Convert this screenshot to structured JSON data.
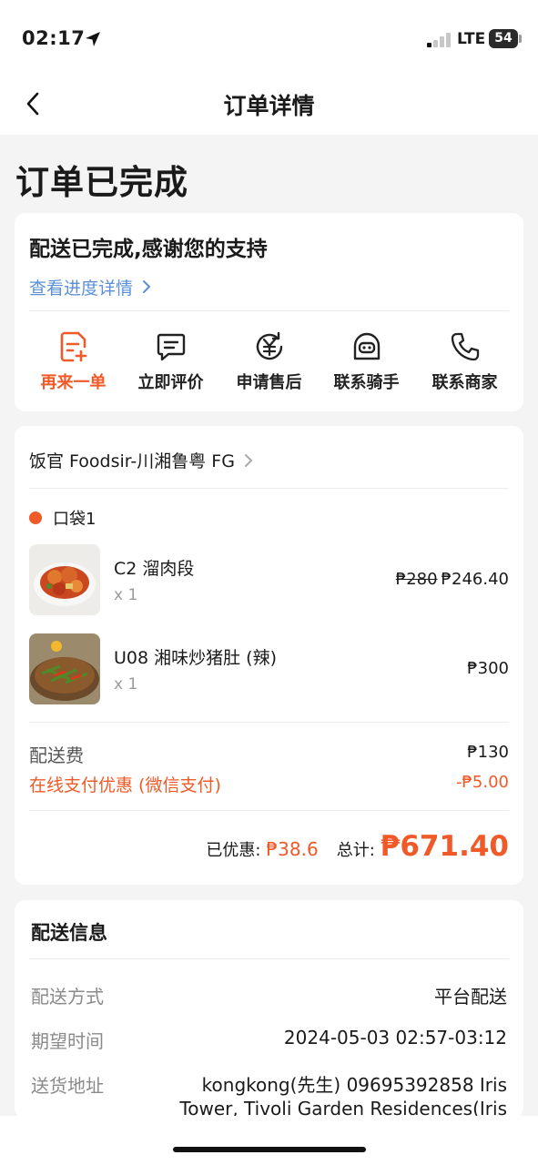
{
  "status_bar": {
    "time": "02:17",
    "network": "LTE",
    "battery": "54"
  },
  "nav": {
    "title": "订单详情"
  },
  "order_status": "订单已完成",
  "delivery_card": {
    "message": "配送已完成,感谢您的支持",
    "progress_link": "查看进度详情",
    "actions": [
      {
        "label": "再来一单",
        "icon": "reorder-icon"
      },
      {
        "label": "立即评价",
        "icon": "review-icon"
      },
      {
        "label": "申请售后",
        "icon": "after-sales-icon"
      },
      {
        "label": "联系骑手",
        "icon": "rider-icon"
      },
      {
        "label": "联系商家",
        "icon": "phone-icon"
      }
    ]
  },
  "order_card": {
    "shop_name": "饭官 Foodsir-川湘鲁粤 FG",
    "bag_label": "口袋1",
    "items": [
      {
        "name": "C2 溜肉段",
        "qty": "x 1",
        "original_price": "₱280",
        "price": "₱246.40"
      },
      {
        "name": "U08 湘味炒猪肚 (辣)",
        "qty": "x 1",
        "price": "₱300"
      }
    ],
    "delivery_fee_label": "配送费",
    "delivery_fee": "₱130",
    "discount_label": "在线支付优惠 (微信支付)",
    "discount_value": "-₱5.00",
    "saved_label": "已优惠:",
    "saved_value": "₱38.6",
    "total_label": "总计:",
    "total_value": "₱671.40"
  },
  "delivery_info": {
    "title": "配送信息",
    "method_label": "配送方式",
    "method_value": "平台配送",
    "time_label": "期望时间",
    "time_value": "2024-05-03 02:57-03:12",
    "address_label": "送货地址",
    "address_value": "kongkong(先生) 09695392858 Iris Tower, Tivoli Garden Residences(Iris"
  },
  "colors": {
    "accent": "#f05a28",
    "link": "#5b8fd6"
  }
}
